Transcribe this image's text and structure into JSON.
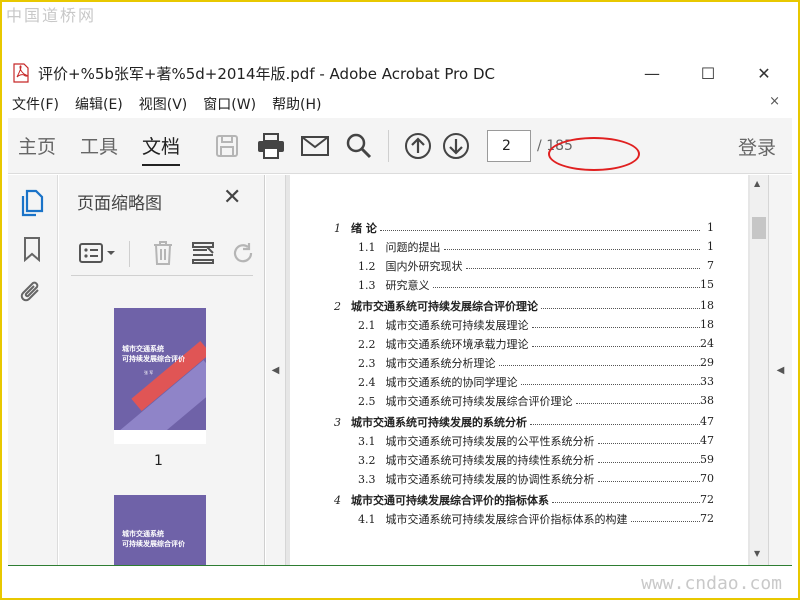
{
  "watermarks": {
    "top": "中国道桥网",
    "bottom": "www.cndao.com"
  },
  "window": {
    "title": "评价+%5b张军+著%5d+2014年版.pdf - Adobe Acrobat Pro DC",
    "minimize": "—",
    "maximize": "☐",
    "close": "✕"
  },
  "menubar": {
    "items": [
      "文件(F)",
      "编辑(E)",
      "视图(V)",
      "窗口(W)",
      "帮助(H)"
    ],
    "close": "×"
  },
  "toolbar": {
    "tabs": [
      "主页",
      "工具",
      "文档"
    ],
    "active_tab": "文档",
    "page_current": "2",
    "page_total": "/ 185",
    "login": "登录"
  },
  "thumbnails": {
    "title": "页面缩略图",
    "close": "✕",
    "cover_title_line1": "城市交通系统",
    "cover_title_line2": "可持续发展综合评价",
    "cover_author": "张 军",
    "page1_label": "1"
  },
  "toc": [
    {
      "num": "1",
      "text": "绪  论",
      "page": "1",
      "chapter": true
    },
    {
      "num": "1.1",
      "text": "问题的提出",
      "page": "1"
    },
    {
      "num": "1.2",
      "text": "国内外研究现状",
      "page": "7"
    },
    {
      "num": "1.3",
      "text": "研究意义",
      "page": "15"
    },
    {
      "num": "2",
      "text": "城市交通系统可持续发展综合评价理论",
      "page": "18",
      "chapter": true
    },
    {
      "num": "2.1",
      "text": "城市交通系统可持续发展理论",
      "page": "18"
    },
    {
      "num": "2.2",
      "text": "城市交通系统环境承载力理论",
      "page": "24"
    },
    {
      "num": "2.3",
      "text": "城市交通系统分析理论",
      "page": "29"
    },
    {
      "num": "2.4",
      "text": "城市交通系统的协同学理论",
      "page": "33"
    },
    {
      "num": "2.5",
      "text": "城市交通系统可持续发展综合评价理论",
      "page": "38"
    },
    {
      "num": "3",
      "text": "城市交通系统可持续发展的系统分析",
      "page": "47",
      "chapter": true
    },
    {
      "num": "3.1",
      "text": "城市交通系统可持续发展的公平性系统分析",
      "page": "47"
    },
    {
      "num": "3.2",
      "text": "城市交通系统可持续发展的持续性系统分析",
      "page": "59"
    },
    {
      "num": "3.3",
      "text": "城市交通系统可持续发展的协调性系统分析",
      "page": "70"
    },
    {
      "num": "4",
      "text": "城市交通可持续发展综合评价的指标体系",
      "page": "72",
      "chapter": true
    },
    {
      "num": "4.1",
      "text": "城市交通系统可持续发展综合评价指标体系的构建",
      "page": "72"
    }
  ],
  "colors": {
    "highlight": "#e02020",
    "cover": "#6f62a8",
    "frame": "#e8c800"
  }
}
